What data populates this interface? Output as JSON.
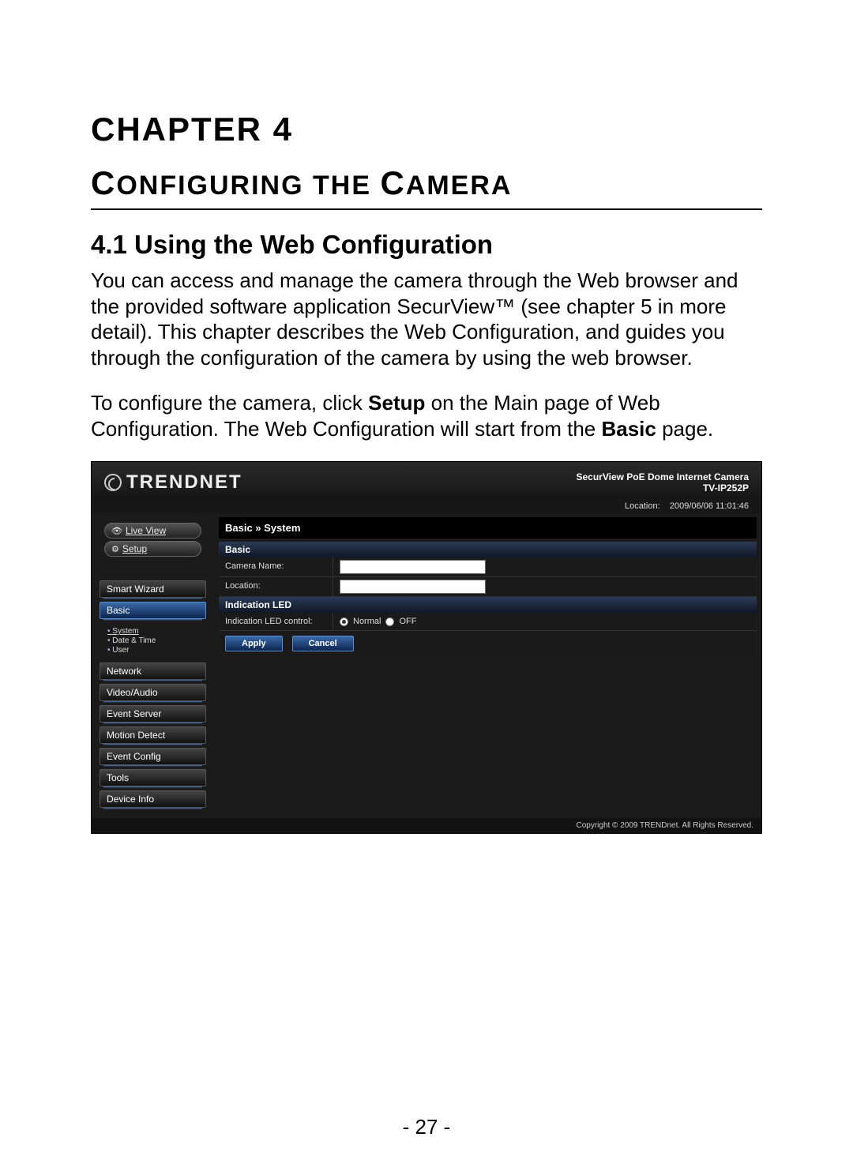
{
  "doc": {
    "chapter_label": "CHAPTER 4",
    "chapter_title_pre": "C",
    "chapter_title_mid1": "ONFIGURING THE ",
    "chapter_title_cap": "C",
    "chapter_title_mid2": "AMERA",
    "section_heading": "4.1  Using the Web Configuration",
    "para1": "You can access and manage the camera through the Web browser and the provided software application SecurView™ (see chapter 5 in more detail). This chapter describes the Web Configuration, and guides you through the configuration of the camera by using the web browser.",
    "para2_a": "To configure the camera, click ",
    "para2_b": "Setup",
    "para2_c": " on the Main page of Web Configuration. The Web Configuration will start from the ",
    "para2_d": "Basic",
    "para2_e": " page.",
    "page_number": "- 27 -"
  },
  "ui": {
    "brand": "TRENDNET",
    "product": "SecurView PoE Dome Internet Camera",
    "model": "TV-IP252P",
    "location_label": "Location:",
    "timestamp": "2009/06/06 11:01:46",
    "live_view": "Live View",
    "setup": "Setup",
    "nav": {
      "smart_wizard": "Smart Wizard",
      "basic": "Basic",
      "sub_system": "System",
      "sub_datetime": "Date & Time",
      "sub_user": "User",
      "network": "Network",
      "video_audio": "Video/Audio",
      "event_server": "Event Server",
      "motion_detect": "Motion Detect",
      "event_config": "Event Config",
      "tools": "Tools",
      "device_info": "Device Info"
    },
    "content": {
      "breadcrumb": "Basic » System",
      "section_basic": "Basic",
      "camera_name_label": "Camera Name:",
      "location_label": "Location:",
      "section_led": "Indication LED",
      "led_control_label": "Indication LED control:",
      "led_normal": "Normal",
      "led_off": "OFF",
      "apply": "Apply",
      "cancel": "Cancel"
    },
    "copyright": "Copyright © 2009 TRENDnet. All Rights Reserved."
  }
}
